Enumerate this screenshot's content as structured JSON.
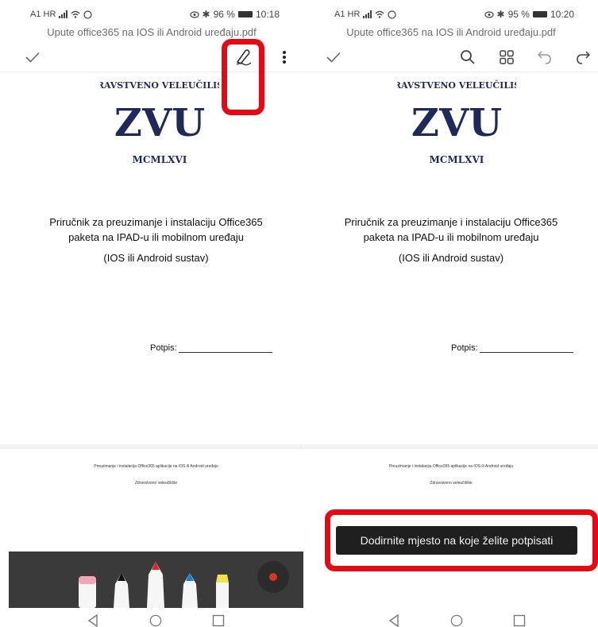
{
  "left": {
    "status": {
      "carrier": "A1 HR",
      "battery": "96 %",
      "time": "10:18"
    },
    "doc_title": "Upute office365 na IOS ili Android uređaju.pdf",
    "page": {
      "logo_text_top": "ZDRAVSTVENO VELEUČILIŠTE",
      "logo_mono": "ZVU",
      "logo_year": "MCMLXVI",
      "line1": "Priručnik za preuzimanje i instalaciju Office365",
      "line2": "paketa na IPAD-u ili mobilnom uređaju",
      "line3": "(IOS ili Android sustav)",
      "signature_label": "Potpis:"
    },
    "page2": {
      "footer1": "Preuzimanje i instalacija Office365 aplikacije na IOS ili Android uređaju",
      "footer2": "Zdravstveno veleučilište"
    }
  },
  "right": {
    "status": {
      "carrier": "A1 HR",
      "battery": "95 %",
      "time": "10:20"
    },
    "doc_title": "Upute office365 na IOS ili Android uređaju.pdf",
    "page": {
      "logo_text_top": "ZDRAVSTVENO VELEUČILIŠTE",
      "logo_mono": "ZVU",
      "logo_year": "MCMLXVI",
      "line1": "Priručnik za preuzimanje i instalaciju Office365",
      "line2": "paketa na IPAD-u ili mobilnom uređaju",
      "line3": "(IOS ili Android sustav)",
      "signature_label": "Potpis:"
    },
    "page2": {
      "footer1": "Preuzimanje i instalacija Office365 aplikacije na IOS ili Android uređaju",
      "footer2": "Zdravstveno veleučilište"
    },
    "toast": "Dodirnite mjesto na koje želite potpisati"
  },
  "icons": {
    "check": "check-icon",
    "signature": "pen-signature-icon",
    "more": "more-vertical-icon",
    "search": "search-icon",
    "grid": "grid-icon",
    "undo": "undo-icon",
    "redo": "redo-icon"
  },
  "colors": {
    "highlight": "#e50914",
    "logo_navy": "#1f2a5a",
    "tray": "#3a3a3a"
  }
}
